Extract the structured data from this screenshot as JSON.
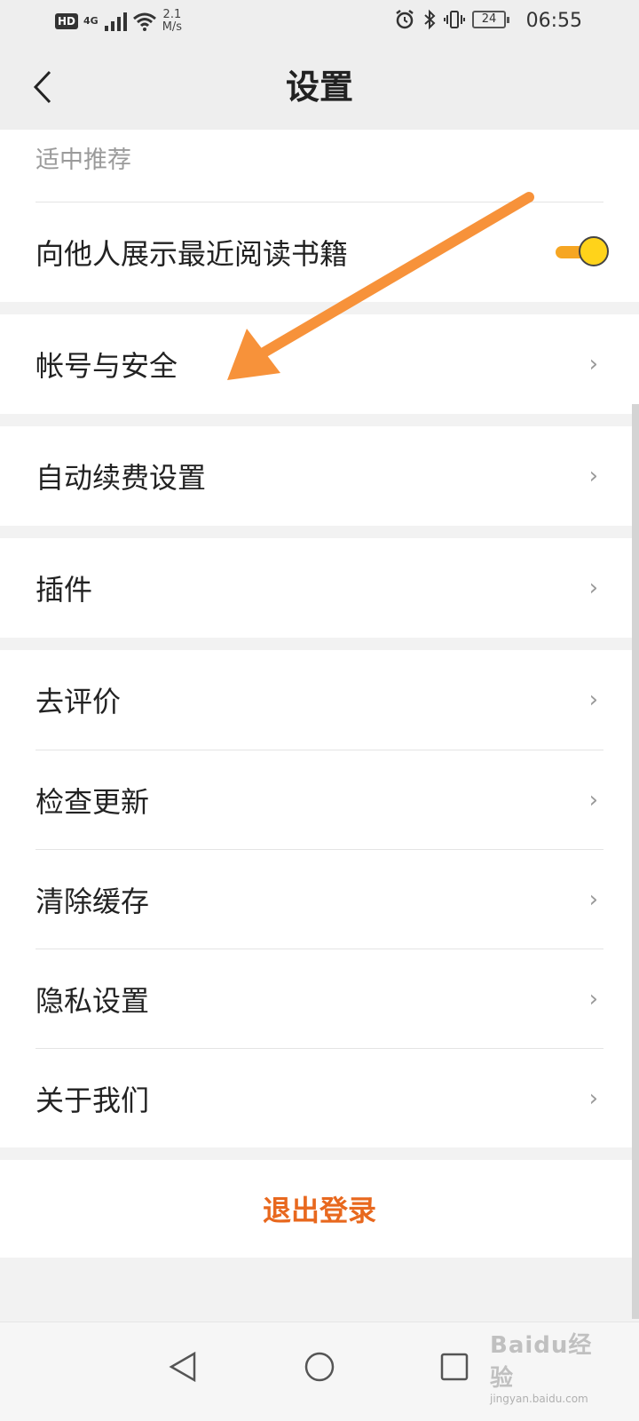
{
  "status_bar": {
    "hd": "HD",
    "network": "4G",
    "speed_value": "2.1",
    "speed_unit": "M/s",
    "battery": "24",
    "time": "06:55"
  },
  "header": {
    "title": "设置"
  },
  "partial_row": {
    "subtitle": "适中推荐"
  },
  "show_reading": {
    "label": "向他人展示最近阅读书籍",
    "enabled": true
  },
  "sections": [
    {
      "label": "帐号与安全"
    },
    {
      "label": "自动续费设置"
    },
    {
      "label": "插件"
    }
  ],
  "group": [
    {
      "label": "去评价"
    },
    {
      "label": "检查更新"
    },
    {
      "label": "清除缓存"
    },
    {
      "label": "隐私设置"
    },
    {
      "label": "关于我们"
    }
  ],
  "logout": {
    "label": "退出登录"
  },
  "watermark": {
    "brand": "Baidu经验",
    "url": "jingyan.baidu.com"
  },
  "colors": {
    "accent": "#e8681e",
    "toggle_track": "#f6a623",
    "toggle_knob": "#ffd31a",
    "arrow": "#f7923a"
  }
}
